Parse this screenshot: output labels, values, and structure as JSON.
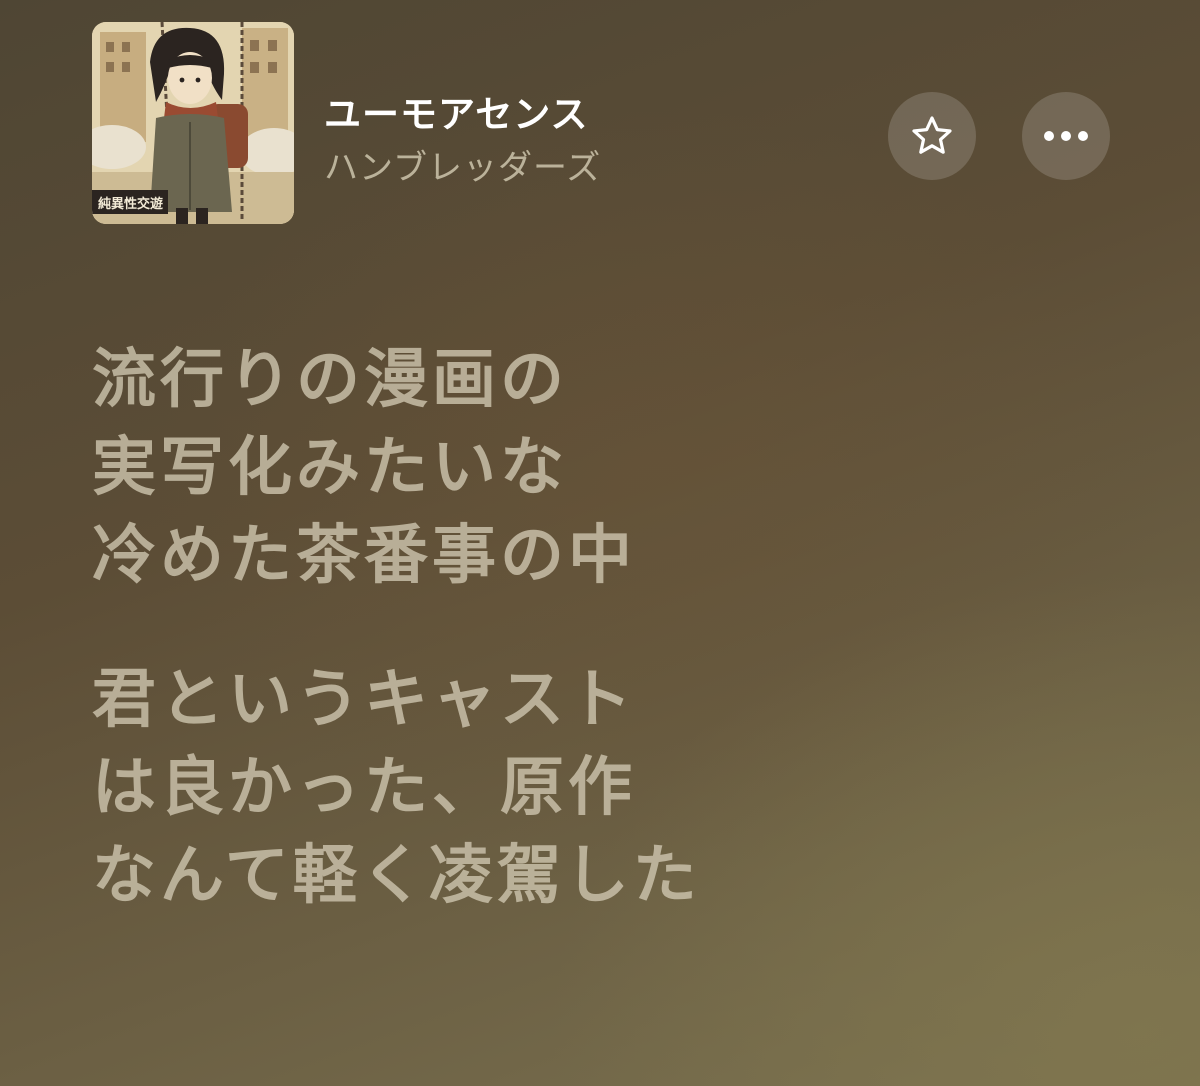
{
  "track": {
    "title": "ユーモアセンス",
    "artist": "ハンブレッダーズ",
    "artwork": {
      "badge_text": "純異性交遊"
    }
  },
  "icons": {
    "favorite": "star-outline-icon",
    "more": "ellipsis-icon"
  },
  "lyrics": {
    "stanzas": [
      {
        "lines": [
          "流行りの漫画の",
          "実写化みたいな",
          "冷めた茶番事の中"
        ]
      },
      {
        "lines": [
          "君というキャスト",
          "は良かった、原作",
          "なんて軽く凌駕した"
        ]
      }
    ]
  },
  "colors": {
    "title": "#ffffff",
    "artist": "#cdc4ac",
    "lyrics": "#cec5af",
    "button_bg": "#6e6450"
  }
}
